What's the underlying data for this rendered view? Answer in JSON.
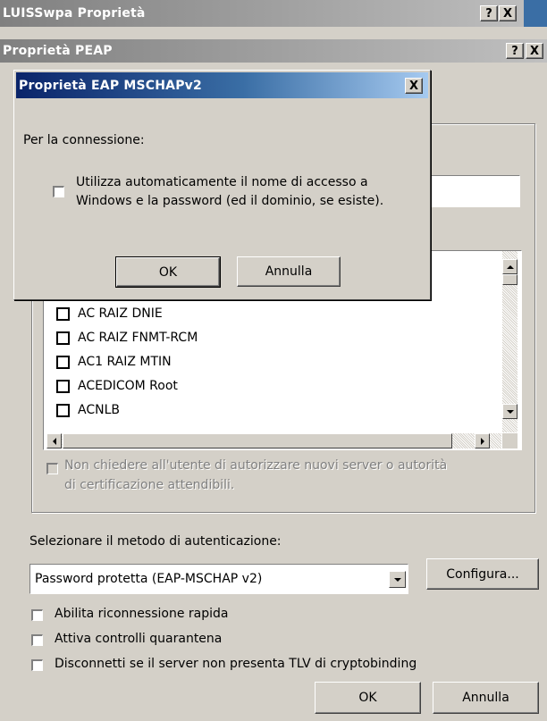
{
  "outer_window": {
    "title": "LUISSwpa Proprietà",
    "help_button": "?",
    "close_button": "X"
  },
  "peap_window": {
    "title": "Proprietà PEAP",
    "help_button": "?",
    "close_button": "X",
    "certificates": [
      "AC RAIZ DNIE",
      "AC RAIZ FNMT-RCM",
      "AC1 RAIZ MTIN",
      "ACEDICOM Root",
      "ACNLB"
    ],
    "no_prompt_checkbox": {
      "line1": "Non chiedere all'utente di autorizzare nuovi server o autorità",
      "line2": "di certificazione attendibili."
    },
    "auth_method_label": "Selezionare il metodo di autenticazione:",
    "auth_method_value": "Password protetta (EAP-MSCHAP v2)",
    "configure_button": "Configura...",
    "options": [
      "Abilita riconnessione rapida",
      "Attiva controlli quarantena",
      "Disconnetti se il server non presenta TLV di cryptobinding"
    ],
    "ok_button": "OK",
    "cancel_button": "Annulla"
  },
  "mschap_dialog": {
    "title": "Proprietà EAP MSCHAPv2",
    "close_button": "X",
    "connection_label": "Per la connessione:",
    "auto_login_line1": "Utilizza automaticamente il nome di accesso a",
    "auto_login_line2": "Windows e la password (ed il dominio, se esiste).",
    "ok_button": "OK",
    "cancel_button": "Annulla"
  }
}
